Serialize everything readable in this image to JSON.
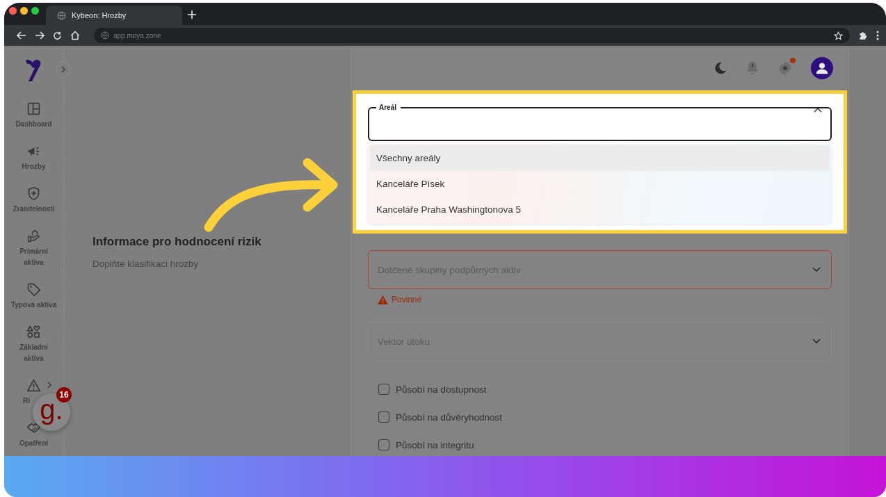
{
  "browser": {
    "tab_title": "Kybeon: Hrozby",
    "url": "app.moya.zone"
  },
  "sidebar": {
    "items": [
      {
        "label": "Dashboard",
        "has_submenu": false
      },
      {
        "label": "Hrozby",
        "has_submenu": false
      },
      {
        "label": "Zranitelnosti",
        "has_submenu": false
      },
      {
        "label": "Primární aktiva",
        "has_submenu": false
      },
      {
        "label": "Typová aktiva",
        "has_submenu": false
      },
      {
        "label": "Základní aktiva",
        "has_submenu": false
      },
      {
        "label": "Ri",
        "has_submenu": true
      },
      {
        "label": "Opatření",
        "has_submenu": false
      }
    ]
  },
  "header": {
    "settings_alert": true
  },
  "section": {
    "title": "Informace pro hodnocení rizik",
    "subtitle": "Doplňte klasifikaci hrozby"
  },
  "area_select": {
    "label": "Areál",
    "expanded": true,
    "options": [
      {
        "label": "Všechny areály",
        "selected": true
      },
      {
        "label": "Kanceláře Písek",
        "selected": false
      },
      {
        "label": "Kanceláře Praha Washingtonova 5",
        "selected": false
      }
    ]
  },
  "support_groups_select": {
    "placeholder": "Dotčené skupiny podpůrných aktiv",
    "error": "Povinné"
  },
  "attack_vector_select": {
    "placeholder": "Vektor útoku"
  },
  "checkboxes": [
    {
      "label": "Působí na dostupnost",
      "checked": false
    },
    {
      "label": "Působí na důvěryhodnost",
      "checked": false
    },
    {
      "label": "Působí na integritu",
      "checked": false
    }
  ],
  "chat_widget": {
    "logo_text": "g.",
    "badge_count": "16"
  }
}
